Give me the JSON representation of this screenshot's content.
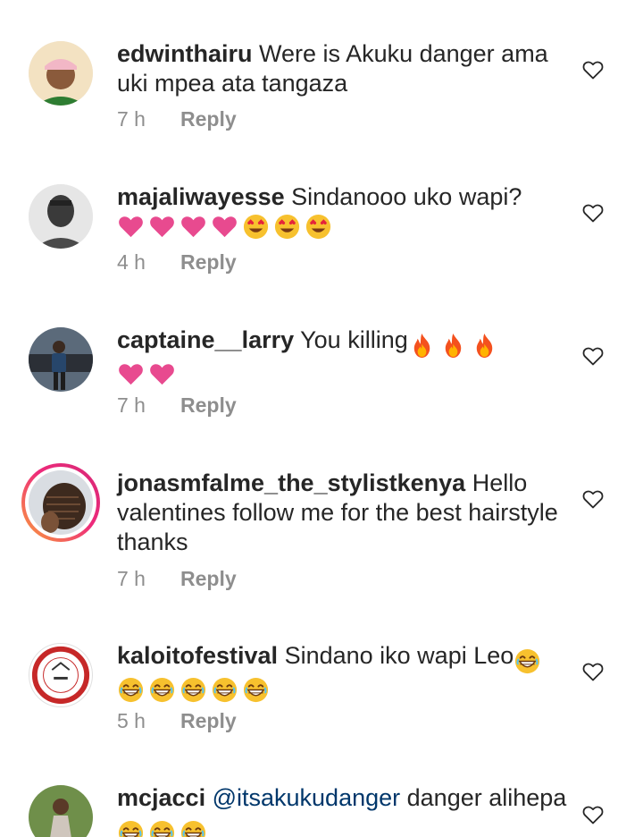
{
  "comments": [
    {
      "username": "edwinthairu",
      "text": "Were is Akuku danger ama uki mpea ata tangaza",
      "time": "7 h",
      "reply_label": "Reply"
    },
    {
      "username": "majaliwayesse",
      "text": "Sindanooo uko wapi?",
      "emojis": [
        "heart",
        "heart",
        "heart",
        "heart",
        "heart-eyes",
        "heart-eyes",
        "heart-eyes"
      ],
      "time": "4 h",
      "reply_label": "Reply"
    },
    {
      "username": "captaine__larry",
      "text": "You killing",
      "inline_emojis": [
        "fire",
        "fire",
        "fire"
      ],
      "emojis": [
        "heart",
        "heart"
      ],
      "time": "7 h",
      "reply_label": "Reply"
    },
    {
      "username": "jonasmfalme_the_stylistkenya",
      "text": "Hello valentines follow me for the best hairstyle thanks",
      "time": "7 h",
      "reply_label": "Reply"
    },
    {
      "username": "kaloitofestival",
      "text": "Sindano iko wapi Leo",
      "inline_emojis": [
        "grin"
      ],
      "emojis": [
        "grin",
        "grin",
        "grin",
        "grin",
        "grin"
      ],
      "time": "5 h",
      "reply_label": "Reply"
    },
    {
      "username": "mcjacci",
      "mention": "@itsakukudanger",
      "text": "danger alihepa",
      "inline_emojis": [
        "grin",
        "grin",
        "grin"
      ]
    }
  ],
  "colors": {
    "text": "#262626",
    "meta": "#8e8e8e",
    "mention": "#00376b",
    "heart_pink": "#e84a8f"
  }
}
